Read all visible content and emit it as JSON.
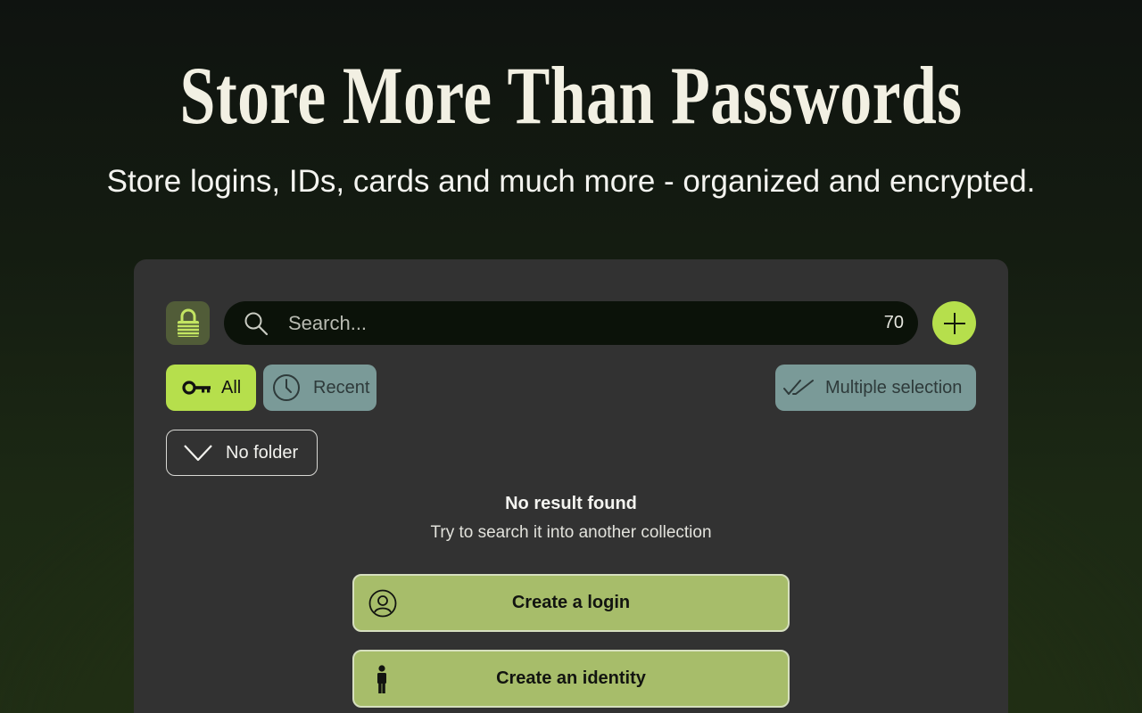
{
  "hero": {
    "title": "Store More Than Passwords",
    "subtitle": "Store logins, IDs, cards and much more - organized and encrypted."
  },
  "toolbar": {
    "logo_icon": "lock-icon",
    "search_placeholder": "Search...",
    "item_count": "70",
    "add_icon": "plus-icon"
  },
  "filters": {
    "all_label": "All",
    "recent_label": "Recent",
    "multi_label": "Multiple selection"
  },
  "folder": {
    "label": "No folder"
  },
  "empty_state": {
    "title": "No result found",
    "subtitle": "Try to search it into another collection"
  },
  "actions": {
    "create_login": "Create a login",
    "create_identity": "Create an identity"
  },
  "colors": {
    "accent": "#b6df4c",
    "panel": "#323232",
    "secondary_pill": "#7a9a98",
    "action_button": "#a7bd6a"
  }
}
